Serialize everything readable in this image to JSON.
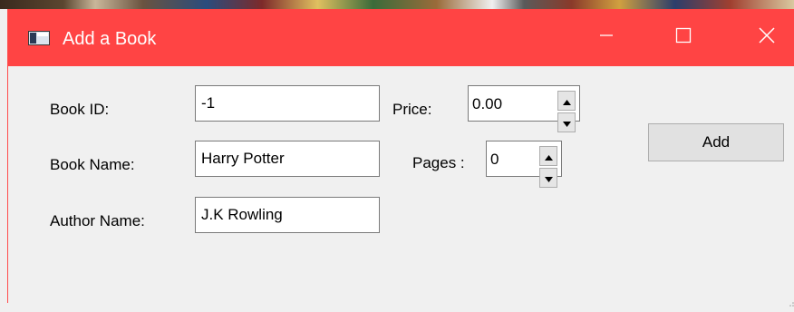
{
  "window": {
    "title": "Add a Book",
    "title_bar_color": "#ff4444",
    "icons": [
      "window-app-icon",
      "minimize-icon",
      "maximize-icon",
      "close-icon"
    ]
  },
  "form": {
    "book_id": {
      "label": "Book ID:",
      "value": "-1"
    },
    "book_name": {
      "label": "Book Name:",
      "value": "Harry Potter"
    },
    "author_name": {
      "label": "Author Name:",
      "value": "J.K Rowling"
    },
    "price": {
      "label": "Price:",
      "value": "0.00"
    },
    "pages": {
      "label": "Pages :",
      "value": "0"
    }
  },
  "actions": {
    "add_label": "Add"
  }
}
